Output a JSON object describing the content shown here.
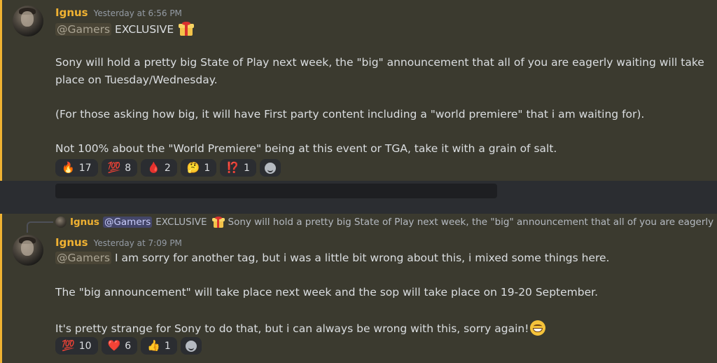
{
  "message1": {
    "username": "Ignus",
    "timestamp": "Yesterday at 6:56 PM",
    "mention": "@Gamers",
    "exclusive": "EXCLUSIVE",
    "line1": "Sony will hold a pretty big State of Play next week, the \"big\" announcement that all of you are eagerly waiting will take",
    "line2": "place on Tuesday/Wednesday.",
    "line3": "(For those asking how big, it will have First party content including a \"world premiere\" that i am waiting for).",
    "line4": "Not 100% about the \"World Premiere\" being at this event or TGA, take it with a grain of salt.",
    "reactions": [
      {
        "emoji": "🔥",
        "count": "17"
      },
      {
        "emoji": "💯",
        "count": "8"
      },
      {
        "emoji": "🩸",
        "count": "2"
      },
      {
        "emoji": "🤔",
        "count": "1"
      },
      {
        "emoji": "⁉️",
        "count": "1"
      }
    ]
  },
  "reply": {
    "username": "Ignus",
    "mention": "@Gamers",
    "exclusive": "EXCLUSIVE",
    "snippet": "Sony will hold a pretty big State of Play next week, the \"big\" announcement that all of you are eagerly ..."
  },
  "message2": {
    "username": "Ignus",
    "timestamp": "Yesterday at 7:09 PM",
    "mention": "@Gamers",
    "line1": "I am sorry for another tag, but i was a little bit wrong about this, i mixed some things here.",
    "line2": "The \"big announcement\" will take place next week and the sop will take place on 19-20 September.",
    "line3": "It's pretty strange for Sony to do that, but i can always be wrong with this, sorry again!",
    "reactions": [
      {
        "emoji": "💯",
        "count": "10"
      },
      {
        "emoji": "❤️",
        "count": "6"
      },
      {
        "emoji": "👍",
        "count": "1"
      }
    ]
  },
  "colors": {
    "accent": "#f0b232",
    "message_bg": "#3b3a2f",
    "channel_bg": "#2b2d31"
  },
  "icons": {
    "add_reaction": "smiley-icon",
    "gift": "gift-icon",
    "grin": "grinning-emoji"
  }
}
